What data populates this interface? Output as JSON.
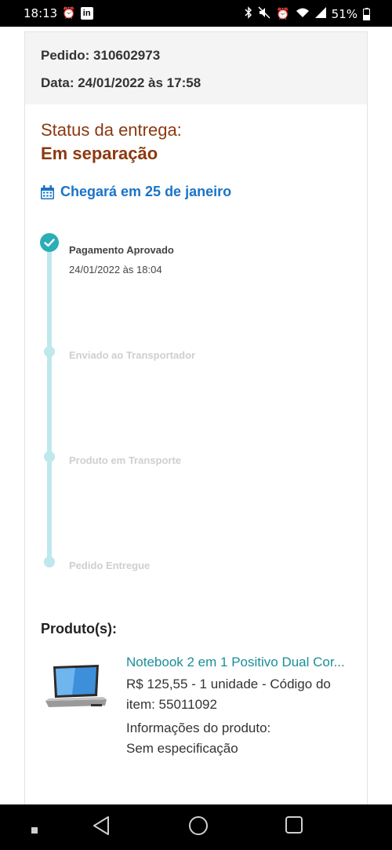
{
  "status_bar": {
    "time": "18:13",
    "battery": "51%",
    "left_icons": [
      "alarm-icon",
      "linkedin-icon"
    ],
    "right_icons": [
      "bluetooth-icon",
      "mute-icon",
      "alarm-icon",
      "wifi-icon",
      "signal-icon",
      "battery-icon"
    ]
  },
  "order": {
    "number_label": "Pedido: 310602973",
    "date_label": "Data: 24/01/2022 às 17:58"
  },
  "delivery": {
    "status_label": "Status da entrega:",
    "status_value": "Em separação",
    "eta": "Chegará em 25 de janeiro"
  },
  "timeline": {
    "steps": [
      {
        "title": "Pagamento Aprovado",
        "date": "24/01/2022 às 18:04",
        "done": true
      },
      {
        "title": "Enviado ao Transportador",
        "done": false
      },
      {
        "title": "Produto em Transporte",
        "done": false
      },
      {
        "title": "Pedido Entregue",
        "done": false
      }
    ]
  },
  "products": {
    "title": "Produto(s):",
    "items": [
      {
        "name": "Notebook 2 em 1 Positivo Dual Cor...",
        "price_line": "R$ 125,55 - 1 unidade - Código do item: 55011092",
        "info_label": "Informações do produto:",
        "info_value": "Sem especificação"
      }
    ]
  },
  "colors": {
    "status": "#8b3a0f",
    "eta": "#1a73c8",
    "timeline_active": "#2aaeb8",
    "timeline_track": "#bfe8ec",
    "product_link": "#1b8e9a"
  }
}
